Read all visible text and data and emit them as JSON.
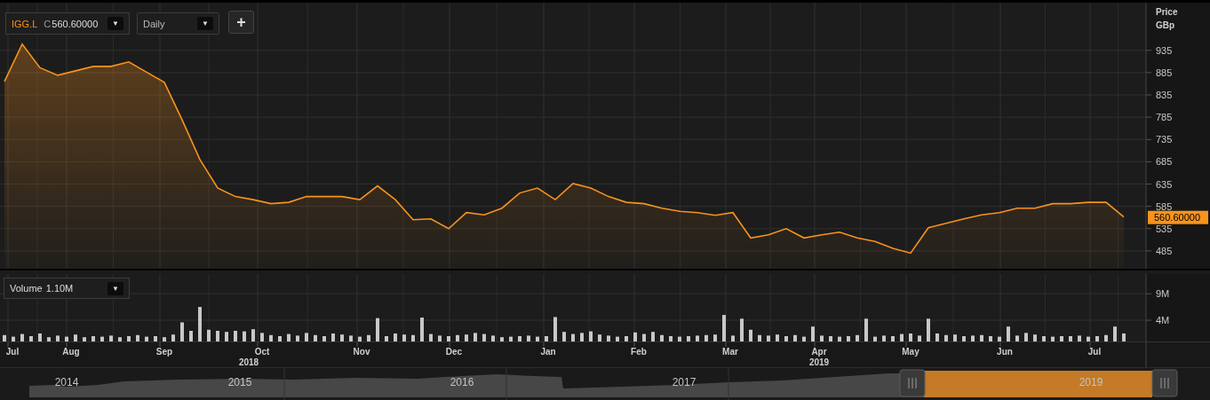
{
  "symbol_selector": {
    "symbol": "IGG.L",
    "close_label": "C",
    "close_value": "560.60000",
    "arrow": "▼"
  },
  "interval_selector": {
    "value": "Daily",
    "arrow": "▼"
  },
  "add_button": {
    "label": "+"
  },
  "price_axis": {
    "title": "Price",
    "unit": "GBp",
    "last_price": "560.60000"
  },
  "price_chart": {
    "chart_data": {
      "type": "area",
      "grid": true,
      "ylim": [
        445,
        1042
      ],
      "yticks": [
        485,
        535,
        585,
        635,
        685,
        735,
        785,
        835,
        885,
        935
      ],
      "series": [
        {
          "color": "#f7931e",
          "values": [
            865,
            949,
            896,
            879,
            889,
            899,
            899,
            909,
            886,
            863,
            779,
            690,
            626,
            607,
            600,
            591,
            594,
            607,
            607,
            607,
            600,
            631,
            600,
            555,
            557,
            535,
            571,
            566,
            581,
            615,
            626,
            600,
            636,
            626,
            607,
            594,
            591,
            581,
            574,
            571,
            565,
            571,
            514,
            521,
            535,
            514,
            521,
            527,
            514,
            506,
            491,
            480,
            537,
            547,
            557,
            566,
            571,
            581,
            581,
            591,
            591,
            594,
            594,
            561
          ]
        }
      ]
    }
  },
  "volume_selector": {
    "label": "Volume",
    "value": "1.10M",
    "arrow": "▼"
  },
  "volume_chart": {
    "chart_data": {
      "type": "bar",
      "grid": true,
      "ylim": [
        0,
        12.7
      ],
      "yticks": [
        {
          "value": 4,
          "label": "4M"
        },
        {
          "value": 9,
          "label": "9M"
        }
      ],
      "series": [
        {
          "color": "#c8c8c8",
          "values": [
            1.2,
            0.9,
            1.4,
            1.0,
            1.5,
            0.8,
            1.1,
            0.9,
            1.3,
            0.8,
            1.0,
            0.9,
            1.1,
            0.8,
            1.0,
            1.2,
            0.9,
            1.0,
            0.8,
            1.3,
            3.6,
            2.0,
            6.5,
            2.2,
            2.0,
            1.8,
            2.0,
            1.9,
            2.3,
            1.6,
            1.2,
            1.0,
            1.4,
            1.1,
            1.6,
            1.2,
            1.0,
            1.5,
            1.3,
            1.1,
            0.9,
            1.2,
            4.4,
            1.0,
            1.5,
            1.3,
            1.2,
            4.5,
            1.4,
            1.1,
            1.0,
            1.2,
            1.3,
            1.6,
            1.4,
            1.1,
            0.8,
            0.9,
            1.0,
            1.1,
            0.9,
            1.0,
            4.6,
            1.8,
            1.4,
            1.6,
            1.9,
            1.3,
            1.1,
            0.9,
            1.0,
            1.7,
            1.4,
            1.8,
            1.2,
            1.0,
            0.9,
            1.0,
            1.1,
            1.2,
            1.3,
            5.0,
            1.1,
            4.3,
            2.2,
            1.2,
            1.1,
            1.3,
            1.0,
            1.2,
            0.9,
            2.8,
            1.1,
            1.0,
            0.9,
            1.0,
            1.2,
            4.3,
            0.9,
            1.1,
            1.0,
            1.4,
            1.5,
            1.1,
            4.3,
            1.5,
            1.2,
            1.3,
            1.0,
            1.1,
            1.2,
            1.0,
            0.9,
            2.8,
            1.1,
            1.6,
            1.3,
            1.0,
            0.9,
            1.0,
            1.0,
            1.1,
            0.9,
            1.0,
            1.2,
            2.8,
            1.5
          ]
        }
      ]
    }
  },
  "time_axis": {
    "months": [
      "Jul",
      "Aug",
      "Sep",
      "Oct",
      "Nov",
      "Dec",
      "Jan",
      "Feb",
      "Mar",
      "Apr",
      "May",
      "Jun",
      "Jul"
    ],
    "years": [
      "2018",
      "2019"
    ]
  },
  "navigator": {
    "years": [
      "2014",
      "2015",
      "2016",
      "2017",
      "2019"
    ]
  }
}
